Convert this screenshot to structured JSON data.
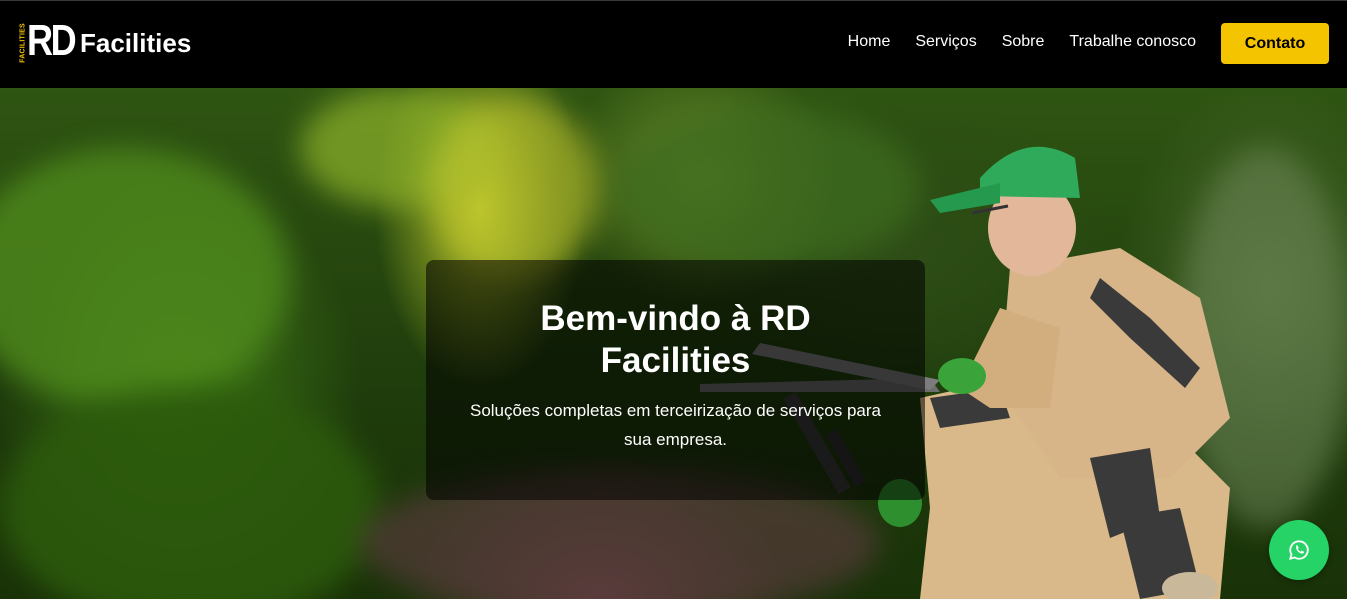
{
  "brand": {
    "logo_vertical_text": "FACILITIES",
    "logo_mark": "RD",
    "name": "Facilities"
  },
  "nav": {
    "links": [
      {
        "label": "Home"
      },
      {
        "label": "Serviços"
      },
      {
        "label": "Sobre"
      },
      {
        "label": "Trabalhe conosco"
      }
    ],
    "cta_label": "Contato"
  },
  "hero": {
    "title": "Bem-vindo à RD Facilities",
    "subtitle": "Soluções completas em terceirização de serviços para sua empresa."
  },
  "floating": {
    "whatsapp_icon": "whatsapp-icon"
  },
  "colors": {
    "accent": "#f5c400",
    "navbar_bg": "#000000",
    "whatsapp": "#25d366"
  }
}
